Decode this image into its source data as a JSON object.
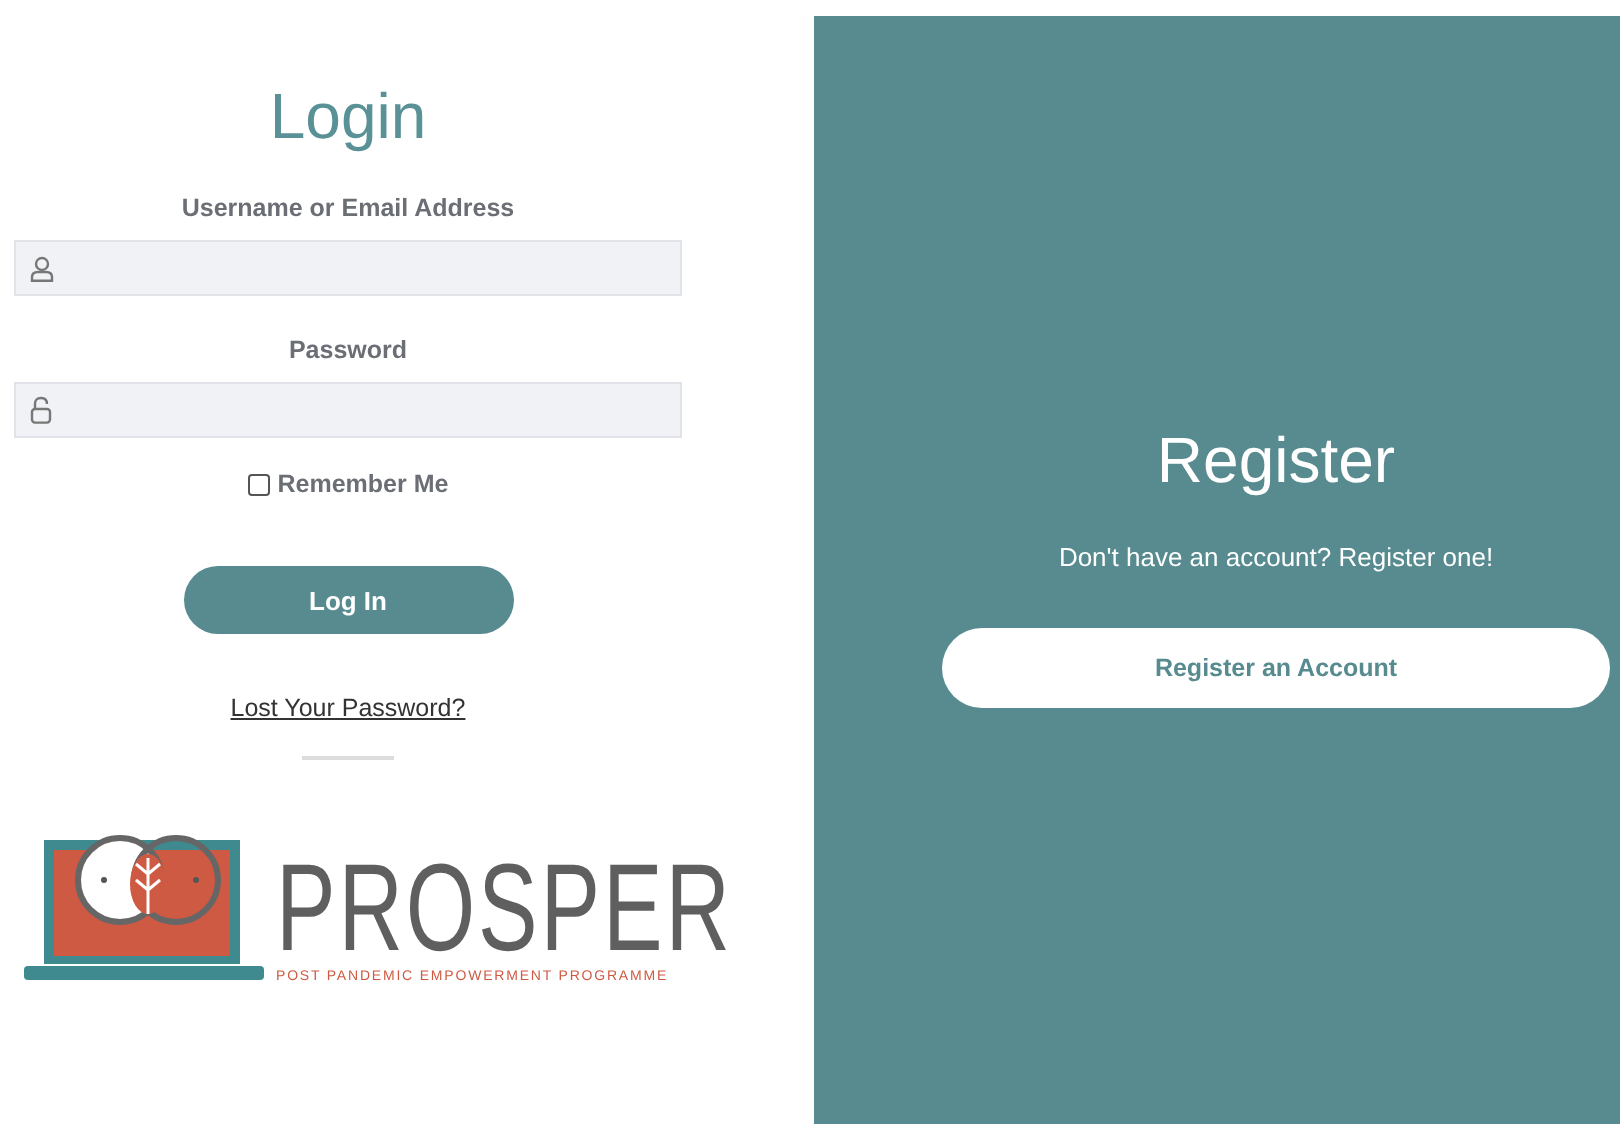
{
  "login": {
    "title": "Login",
    "fields": [
      {
        "label": "Username or Email Address",
        "kind": "user"
      },
      {
        "label": "Password",
        "kind": "lock"
      }
    ],
    "remember": {
      "label": "Remember Me",
      "checked": false
    },
    "button": "Log In",
    "lost_password": "Lost Your Password?"
  },
  "logo": {
    "name": "PROSPER",
    "tagline": "POST PANDEMIC EMPOWERMENT PROGRAMME"
  },
  "register": {
    "title": "Register",
    "text": "Don't have an account? Register one!",
    "button": "Register an Account"
  }
}
